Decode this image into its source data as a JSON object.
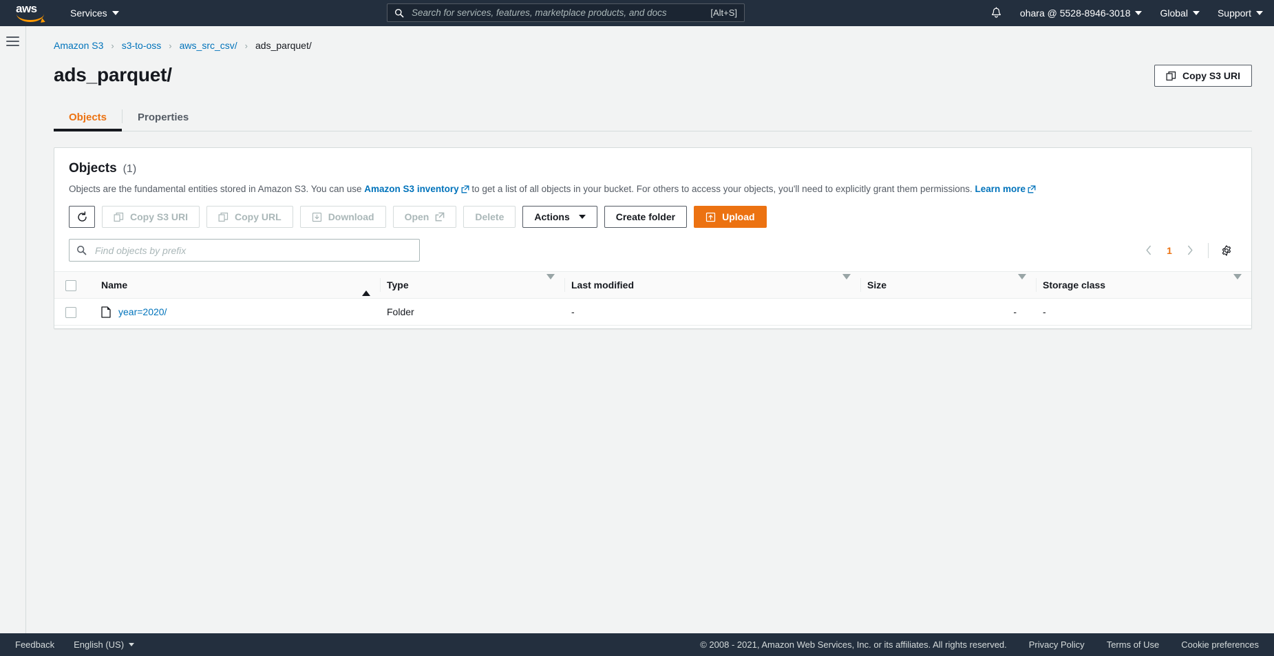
{
  "topnav": {
    "logo_text": "aws",
    "services_label": "Services",
    "search": {
      "placeholder": "Search for services, features, marketplace products, and docs",
      "value": "",
      "shortcut": "[Alt+S]"
    },
    "account_label": "ohara @ 5528-8946-3018",
    "region_label": "Global",
    "support_label": "Support"
  },
  "breadcrumb": {
    "items": [
      {
        "label": "Amazon S3",
        "link": true
      },
      {
        "label": "s3-to-oss",
        "link": true
      },
      {
        "label": "aws_src_csv/",
        "link": true
      },
      {
        "label": "ads_parquet/",
        "link": false
      }
    ],
    "separator": "›"
  },
  "page": {
    "title": "ads_parquet/",
    "copy_uri_label": "Copy S3 URI"
  },
  "tabs": [
    {
      "label": "Objects",
      "active": true
    },
    {
      "label": "Properties",
      "active": false
    }
  ],
  "panel": {
    "title": "Objects",
    "count": "(1)",
    "description_part1": "Objects are the fundamental entities stored in Amazon S3. You can use",
    "inventory_link": "Amazon S3 inventory",
    "description_part2": "to get a list of all objects in your bucket. For others to access your objects, you'll need to explicitly grant them permissions.",
    "learn_more": "Learn more",
    "actions": {
      "refresh_label": "",
      "copy_s3_uri": "Copy S3 URI",
      "copy_url": "Copy URL",
      "download": "Download",
      "open": "Open",
      "delete": "Delete",
      "actions_menu": "Actions",
      "create_folder": "Create folder",
      "upload": "Upload"
    },
    "filter": {
      "placeholder": "Find objects by prefix",
      "value": ""
    },
    "pagination": {
      "prev": "‹",
      "page": "1",
      "next": "›"
    },
    "table": {
      "columns": [
        {
          "label": "Name",
          "sort": "asc"
        },
        {
          "label": "Type",
          "sort": "none"
        },
        {
          "label": "Last modified",
          "sort": "none"
        },
        {
          "label": "Size",
          "sort": "none"
        },
        {
          "label": "Storage class",
          "sort": "none"
        }
      ],
      "rows": [
        {
          "name": "year=2020/",
          "type": "Folder",
          "last_modified": "-",
          "size": "-",
          "storage_class": "-"
        }
      ]
    }
  },
  "footer": {
    "feedback": "Feedback",
    "language": "English (US)",
    "copyright": "© 2008 - 2021, Amazon Web Services, Inc. or its affiliates. All rights reserved.",
    "privacy": "Privacy Policy",
    "terms": "Terms of Use",
    "cookies": "Cookie preferences"
  },
  "colors": {
    "nav_bg": "#232f3e",
    "accent_orange": "#ec7211",
    "link_blue": "#0073bb",
    "page_bg": "#f2f3f3"
  }
}
